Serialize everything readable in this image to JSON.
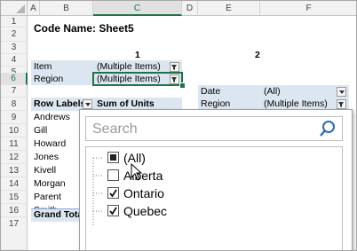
{
  "columns": [
    "A",
    "B",
    "C",
    "D",
    "E",
    "F"
  ],
  "rows": [
    "1",
    "2",
    "3",
    "4",
    "5",
    "6",
    "7",
    "8",
    "9",
    "10",
    "11",
    "12",
    "13",
    "14",
    "15",
    "16",
    "17"
  ],
  "code_name": "Code Name: Sheet5",
  "pivot1": {
    "number": "1",
    "filters": [
      {
        "label": "Item",
        "value": "(Multiple Items)"
      },
      {
        "label": "Region",
        "value": "(Multiple Items)"
      }
    ],
    "row_labels_header": "Row Labels",
    "sum_header": "Sum of Units",
    "rows": [
      "Andrews",
      "Gill",
      "Howard",
      "Jones",
      "Kivell",
      "Morgan",
      "Parent",
      "Smith"
    ],
    "grand_total": "Grand Total"
  },
  "pivot2": {
    "number": "2",
    "filters": [
      {
        "label": "Date",
        "value": "(All)"
      },
      {
        "label": "Region",
        "value": "(Multiple Items)"
      }
    ]
  },
  "filter_popup": {
    "search_placeholder": "Search",
    "items": [
      {
        "label": "(All)",
        "state": "mixed"
      },
      {
        "label": "Alberta",
        "state": "unchecked"
      },
      {
        "label": "Ontario",
        "state": "checked"
      },
      {
        "label": "Quebec",
        "state": "checked"
      }
    ]
  },
  "colors": {
    "selection": "#217346",
    "pivot_band": "#dce6f1"
  }
}
